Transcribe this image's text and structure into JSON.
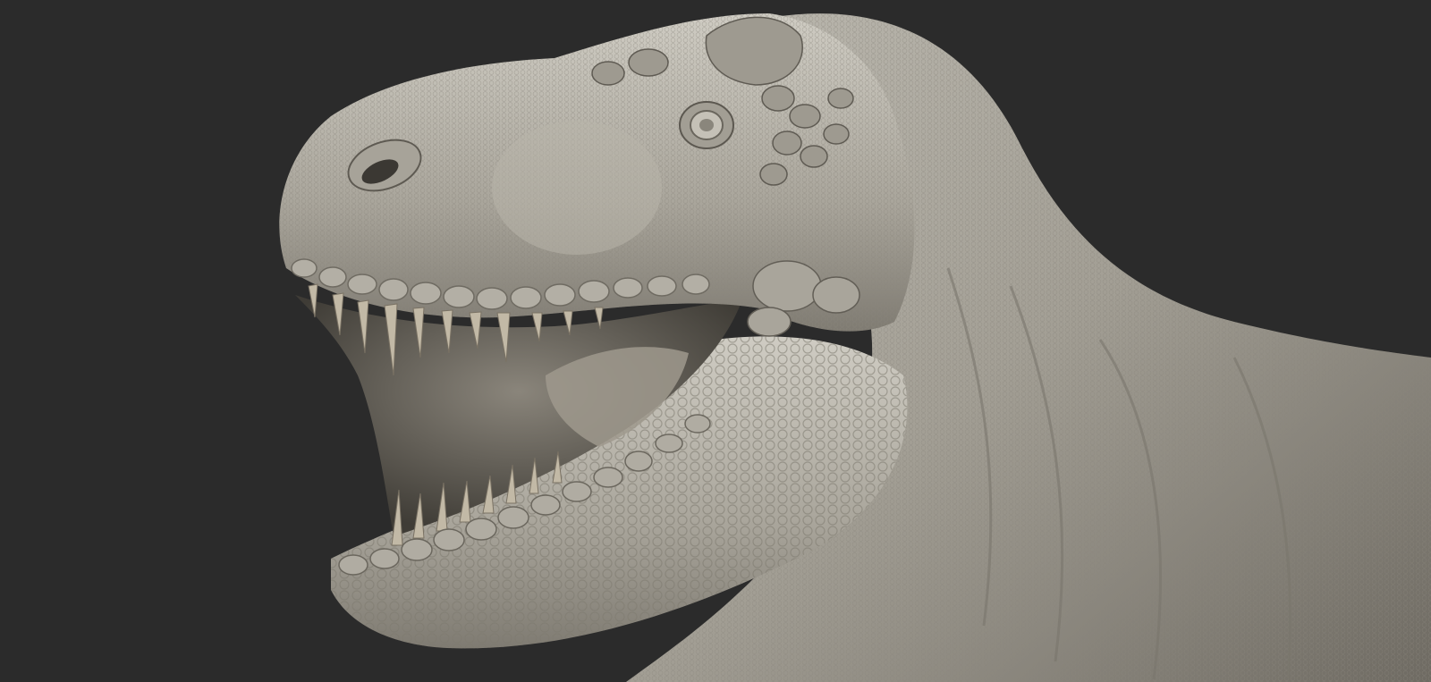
{
  "scene": {
    "subject": "dinosaur-head-sculpt",
    "colors": {
      "background": "#2b2b2b",
      "skin_light": "#c9c6bd",
      "skin_mid": "#9b978d",
      "skin_dark": "#5a5750",
      "mouth_interior": "#4a463f",
      "teeth": "#b9b09e"
    }
  }
}
